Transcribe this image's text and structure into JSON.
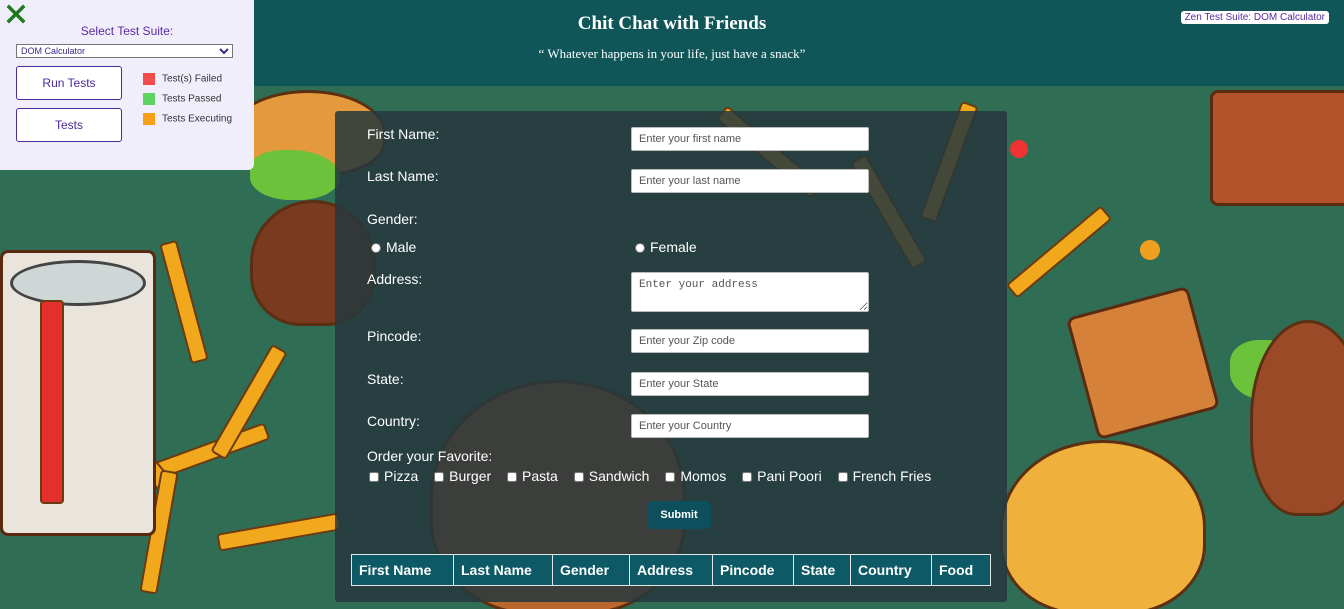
{
  "header": {
    "title": "Chit Chat with Friends",
    "quote": "“ Whatever happens in your life, just have a snack”",
    "suite_badge": "Zen Test Suite: DOM Calculator"
  },
  "test_panel": {
    "select_label": "Select Test Suite:",
    "selected_suite": "DOM Calculator",
    "run_tests_label": "Run Tests",
    "tests_label": "Tests",
    "legend": [
      {
        "label": "Test(s) Failed",
        "color": "#f24b4b"
      },
      {
        "label": "Tests Passed",
        "color": "#5fd35f"
      },
      {
        "label": "Tests Executing",
        "color": "#f6a01a"
      }
    ]
  },
  "form": {
    "first_name_label": "First Name:",
    "first_name_placeholder": "Enter your first name",
    "last_name_label": "Last Name:",
    "last_name_placeholder": "Enter your last name",
    "gender_label": "Gender:",
    "gender_options": [
      "Male",
      "Female"
    ],
    "address_label": "Address:",
    "address_placeholder": "Enter your address",
    "pincode_label": "Pincode:",
    "pincode_placeholder": "Enter your Zip code",
    "state_label": "State:",
    "state_placeholder": "Enter your State",
    "country_label": "Country:",
    "country_placeholder": "Enter your Country",
    "favorite_label": "Order your Favorite:",
    "foods": [
      "Pizza",
      "Burger",
      "Pasta",
      "Sandwich",
      "Momos",
      "Pani Poori",
      "French Fries"
    ],
    "submit_label": "Submit"
  },
  "table": {
    "headers": [
      "First Name",
      "Last Name",
      "Gender",
      "Address",
      "Pincode",
      "State",
      "Country",
      "Food"
    ]
  }
}
